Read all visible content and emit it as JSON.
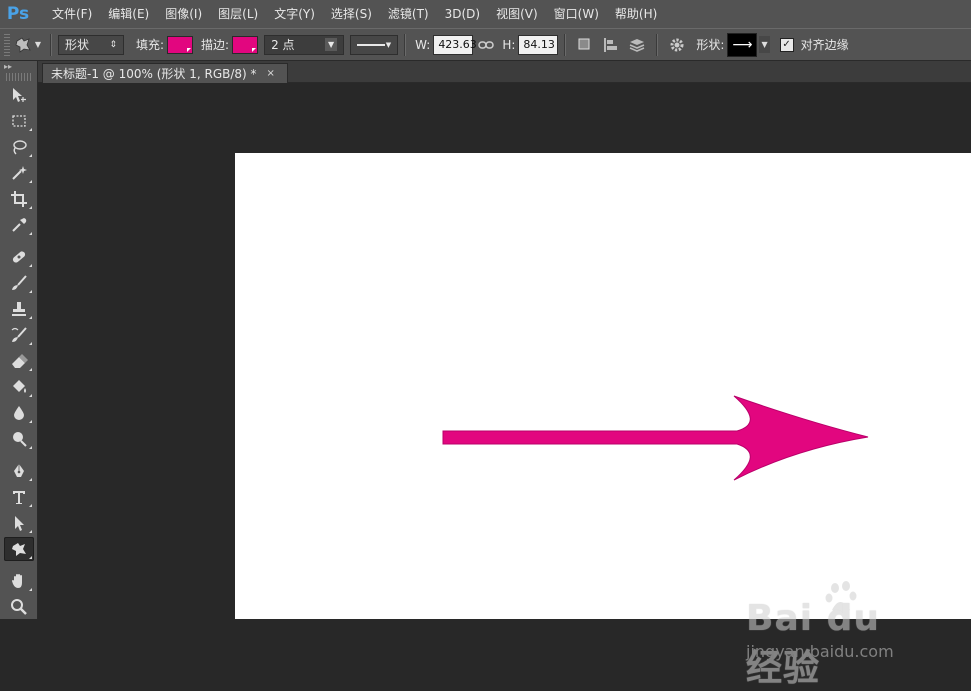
{
  "app": {
    "logo_text": "Ps"
  },
  "menu": {
    "items": [
      "文件(F)",
      "编辑(E)",
      "图像(I)",
      "图层(L)",
      "文字(Y)",
      "选择(S)",
      "滤镜(T)",
      "3D(D)",
      "视图(V)",
      "窗口(W)",
      "帮助(H)"
    ]
  },
  "options": {
    "mode_value": "形状",
    "fill_label": "填充:",
    "stroke_label": "描边:",
    "stroke_size_value": "2 点",
    "width_label": "W:",
    "width_value": "423.63",
    "height_label": "H:",
    "height_value": "84.13",
    "shape_label": "形状:",
    "align_edges_label": "对齐边缘",
    "fill_color": "#e2067f",
    "stroke_color": "#e2067f"
  },
  "document": {
    "tab_title": "未标题-1 @ 100% (形状 1, RGB/8) *",
    "close_glyph": "×"
  },
  "canvas": {
    "arrow_color": "#e2067f"
  },
  "watermark": {
    "brand": "Bai du 经验",
    "url": "jingyan.baidu.com"
  },
  "tools": [
    "move-tool",
    "marquee-tool",
    "lasso-tool",
    "magic-wand-tool",
    "crop-tool",
    "eyedropper-tool",
    "healing-brush-tool",
    "brush-tool",
    "clone-stamp-tool",
    "history-brush-tool",
    "eraser-tool",
    "paint-bucket-tool",
    "blur-tool",
    "dodge-tool",
    "pen-tool",
    "type-tool",
    "path-selection-tool",
    "custom-shape-tool",
    "hand-tool",
    "zoom-tool"
  ]
}
